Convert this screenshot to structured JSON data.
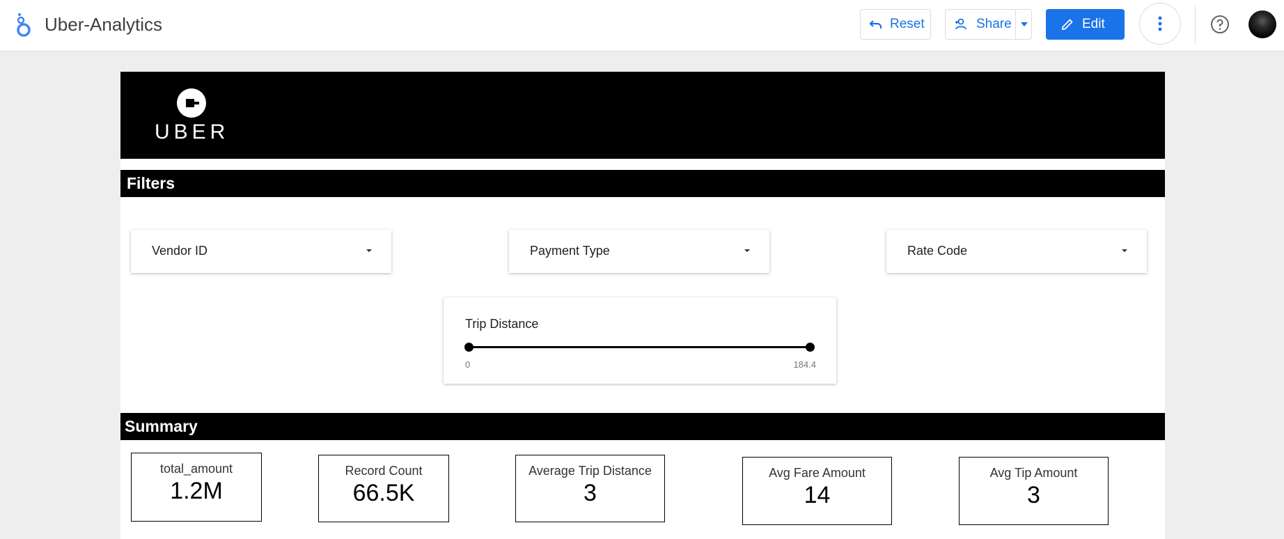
{
  "app": {
    "title": "Uber-Analytics"
  },
  "toolbar": {
    "reset_label": "Reset",
    "share_label": "Share",
    "edit_label": "Edit"
  },
  "banner": {
    "brand_word": "UBER"
  },
  "filters": {
    "heading": "Filters",
    "dropdowns": [
      {
        "label": "Vendor ID"
      },
      {
        "label": "Payment Type"
      },
      {
        "label": "Rate Code"
      }
    ],
    "trip_distance": {
      "label": "Trip Distance",
      "min_label": "0",
      "max_label": "184.4",
      "selected_min": 0,
      "selected_max": 184.4
    }
  },
  "summary": {
    "heading": "Summary",
    "kpis": [
      {
        "label": "total_amount",
        "value": "1.2M"
      },
      {
        "label": "Record Count",
        "value": "66.5K"
      },
      {
        "label": "Average Trip Distance",
        "value": "3"
      },
      {
        "label": "Avg Fare Amount",
        "value": "14"
      },
      {
        "label": "Avg Tip Amount",
        "value": "3"
      }
    ]
  },
  "colors": {
    "accent": "#1a73e8",
    "banner": "#000000",
    "page_bg": "#eeeeee"
  },
  "icons": {
    "app_logo": "looker-studio-logo-icon",
    "reset": "undo-icon",
    "share": "person-add-icon",
    "edit": "pencil-icon",
    "more": "more-vert-icon",
    "help": "help-circle-icon"
  }
}
